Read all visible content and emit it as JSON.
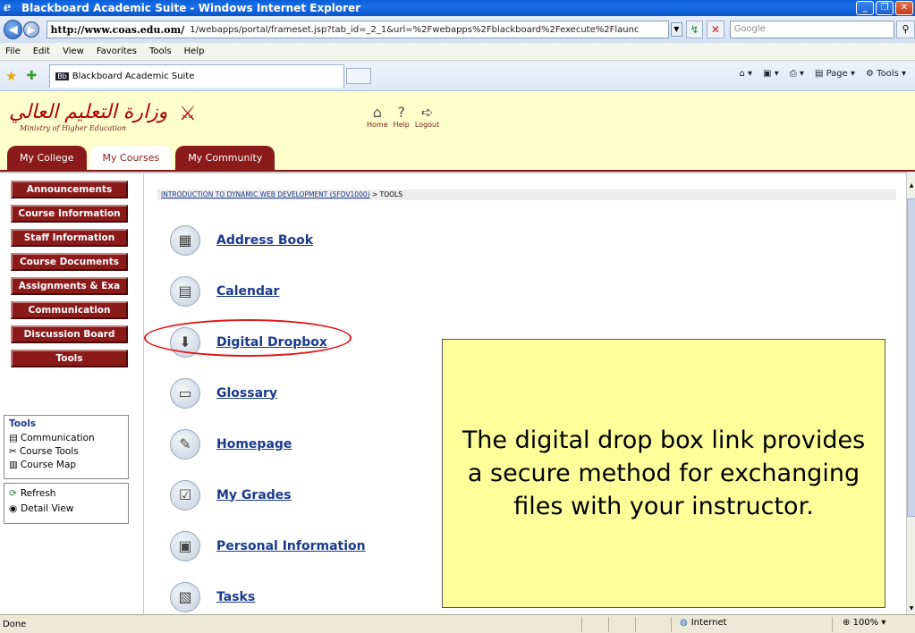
{
  "window": {
    "title": "Blackboard Academic Suite - Windows Internet Explorer",
    "controls": [
      "_",
      "❐",
      "✕"
    ]
  },
  "address": {
    "host": "http://www.coas.edu.om/",
    "path": "1/webapps/portal/frameset.jsp?tab_id=_2_1&url=%2Fwebapps%2Fblackboard%2Fexecute%2Flaunc",
    "search_placeholder": "Google"
  },
  "menu": [
    "File",
    "Edit",
    "View",
    "Favorites",
    "Tools",
    "Help"
  ],
  "browser_tab": {
    "label": "Blackboard Academic Suite",
    "favicon": "Bb"
  },
  "browser_tools": {
    "page": "Page",
    "tools": "Tools"
  },
  "header": {
    "logo_arabic": "وزارة التعليم العالي",
    "logo_english": "Ministry of Higher Education",
    "links": [
      {
        "label": "Home",
        "icon": "home-icon"
      },
      {
        "label": "Help",
        "icon": "help-icon"
      },
      {
        "label": "Logout",
        "icon": "logout-icon"
      }
    ],
    "tabs": [
      {
        "label": "My College"
      },
      {
        "label": "My Courses",
        "active": true
      },
      {
        "label": "My Community"
      }
    ]
  },
  "sidebar": {
    "buttons": [
      "Announcements",
      "Course Information",
      "Staff Information",
      "Course Documents",
      "Assignments & Exa",
      "Communication",
      "Discussion Board",
      "Tools"
    ],
    "tools_box": {
      "heading": "Tools",
      "items": [
        {
          "label": "Communication",
          "icon": "communication-icon"
        },
        {
          "label": "Course Tools",
          "icon": "course-tools-icon"
        },
        {
          "label": "Course Map",
          "icon": "course-map-icon"
        }
      ]
    },
    "view_box": {
      "items": [
        {
          "label": "Refresh",
          "icon": "refresh-icon"
        },
        {
          "label": "Detail View",
          "icon": "detail-view-icon"
        }
      ]
    }
  },
  "breadcrumb": {
    "course": "INTRODUCTION TO DYNAMIC WEB DEVELOPMENT (SFDV1000)",
    "current": "> TOOLS"
  },
  "tools": [
    {
      "label": "Address Book",
      "icon": "address-book-icon"
    },
    {
      "label": "Calendar",
      "icon": "calendar-icon"
    },
    {
      "label": "Digital Dropbox",
      "icon": "dropbox-icon"
    },
    {
      "label": "Glossary",
      "icon": "glossary-icon"
    },
    {
      "label": "Homepage",
      "icon": "homepage-icon"
    },
    {
      "label": "My Grades",
      "icon": "grades-icon"
    },
    {
      "label": "Personal Information",
      "icon": "personal-info-icon"
    },
    {
      "label": "Tasks",
      "icon": "tasks-icon"
    }
  ],
  "callout": {
    "text": "The digital drop box link provides a secure method for exchanging files with your instructor."
  },
  "status": {
    "text": "Done",
    "zone": "Internet",
    "zoom": "100%"
  }
}
